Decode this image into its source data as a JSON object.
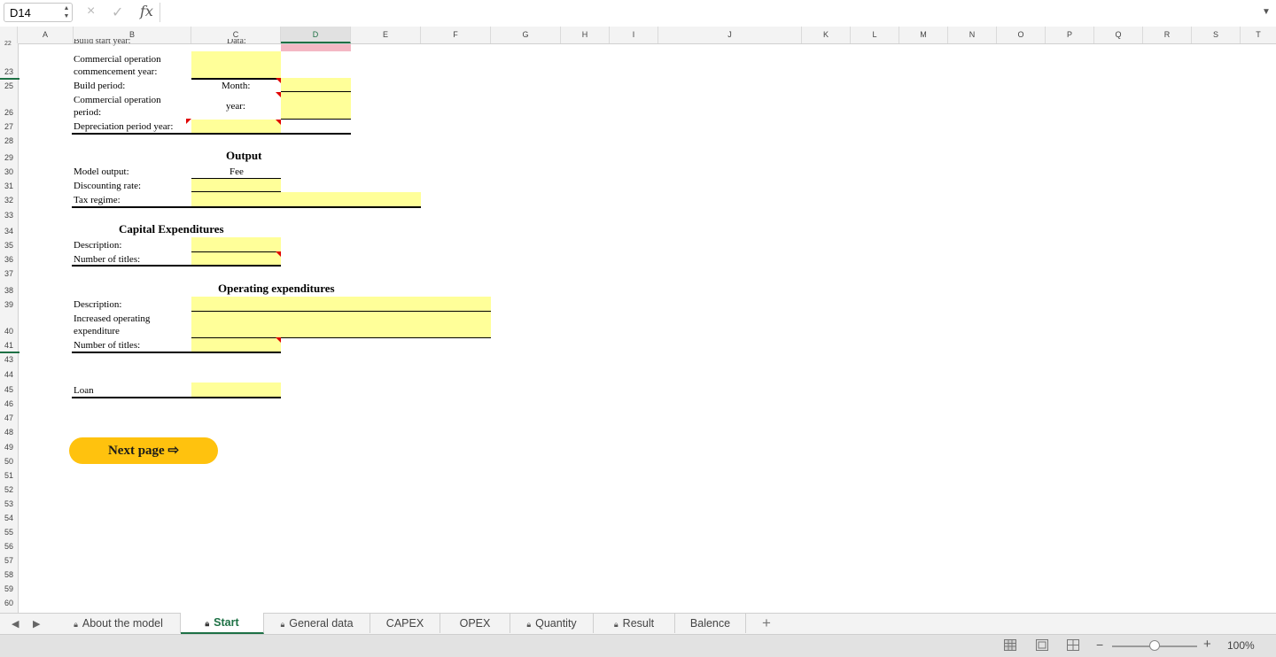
{
  "formula_bar": {
    "cell_ref": "D14",
    "cancel_icon": "×",
    "confirm_icon": "✓",
    "fx_label": "fx",
    "value": ""
  },
  "columns": [
    "A",
    "B",
    "C",
    "D",
    "E",
    "F",
    "G",
    "H",
    "I",
    "J",
    "K",
    "L",
    "M",
    "N",
    "O",
    "P",
    "Q",
    "R",
    "S",
    "T"
  ],
  "selected_column": "D",
  "rows": [
    "22",
    "23",
    "25",
    "26",
    "27",
    "28",
    "29",
    "30",
    "31",
    "32",
    "33",
    "34",
    "35",
    "36",
    "37",
    "38",
    "39",
    "40",
    "41",
    "43",
    "44",
    "45",
    "46",
    "47",
    "48",
    "49",
    "50",
    "51",
    "52",
    "53",
    "54",
    "55",
    "56",
    "57",
    "58",
    "59",
    "60"
  ],
  "cells": {
    "row22_b": "Build start year:",
    "row22_c": "Data:",
    "commercial_op_year_1": "Commercial operation",
    "commercial_op_year_2": "commencement year:",
    "build_period": "Build period:",
    "month_label": "Month:",
    "commercial_op_period_1": "Commercial operation",
    "commercial_op_period_2": "period:",
    "year_label": "year:",
    "depreciation": "Depreciation period year:",
    "output_heading": "Output",
    "fee_label": "Fee",
    "model_output": "Model output:",
    "discounting_rate": "Discounting rate:",
    "tax_regime": "Tax regime:",
    "capex_heading": "Capital Expenditures",
    "capex_description": "Description:",
    "capex_titles": "Number of titles:",
    "opex_heading": "Operating expenditures",
    "opex_description": "Description:",
    "opex_increase_1": "Increased operating",
    "opex_increase_2": "expenditure",
    "opex_titles": "Number of titles:",
    "loan": "Loan"
  },
  "next_button": "Next page ⇨",
  "sheet_tabs": [
    {
      "label": "About the model",
      "locked": true
    },
    {
      "label": "Start",
      "locked": true,
      "active": true
    },
    {
      "label": "General data",
      "locked": true
    },
    {
      "label": "CAPEX",
      "locked": false
    },
    {
      "label": "OPEX",
      "locked": false
    },
    {
      "label": "Quantity",
      "locked": true
    },
    {
      "label": "Result",
      "locked": true
    },
    {
      "label": "Balence",
      "locked": false
    }
  ],
  "add_sheet": "+",
  "status": {
    "zoom_minus": "−",
    "zoom_plus": "+",
    "zoom": "100%",
    "zoom_level": 50
  },
  "colors": {
    "input_fill": "#ffff99",
    "accent": "#1e7145",
    "button": "#ffc20e",
    "comment_marker": "#e00000"
  }
}
